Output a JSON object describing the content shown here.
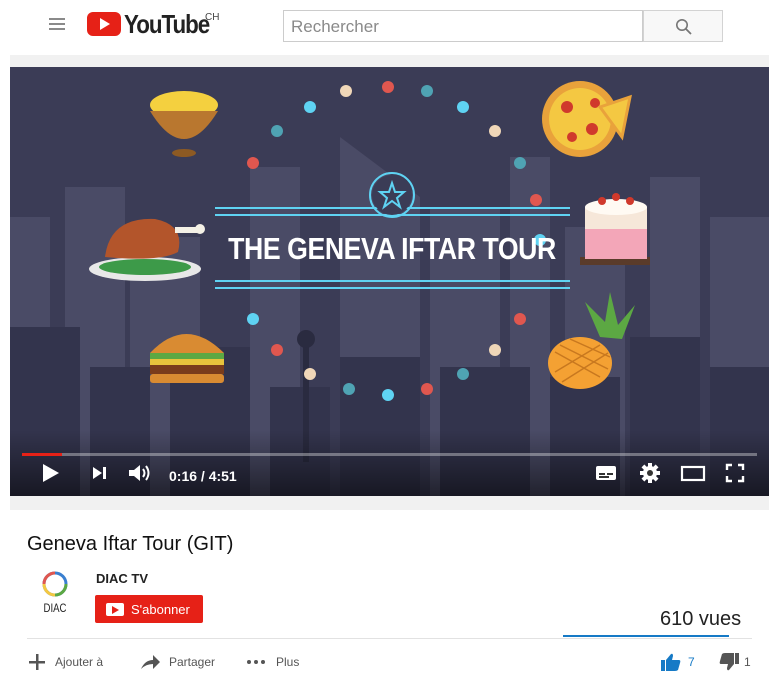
{
  "header": {
    "logo_text": "YouTube",
    "country_code": "CH",
    "search_placeholder": "Rechercher"
  },
  "video": {
    "overlay_title": "THE GENEVA IFTAR TOUR",
    "time_display": "0:16 / 4:51",
    "progress": 0.055,
    "colors": {
      "background": "#3b3c56",
      "accent": "#5fd3f3",
      "progress": "#e62117"
    }
  },
  "info": {
    "title": "Geneva Iftar Tour (GIT)",
    "channel_name": "DIAC TV",
    "channel_logo_text": "DIAC",
    "subscribe_label": "S'abonner",
    "views": "610 vues",
    "like_ratio": 0.875
  },
  "actions": {
    "add_to": "Ajouter à",
    "share": "Partager",
    "more": "Plus",
    "likes": "7",
    "dislikes": "1"
  }
}
